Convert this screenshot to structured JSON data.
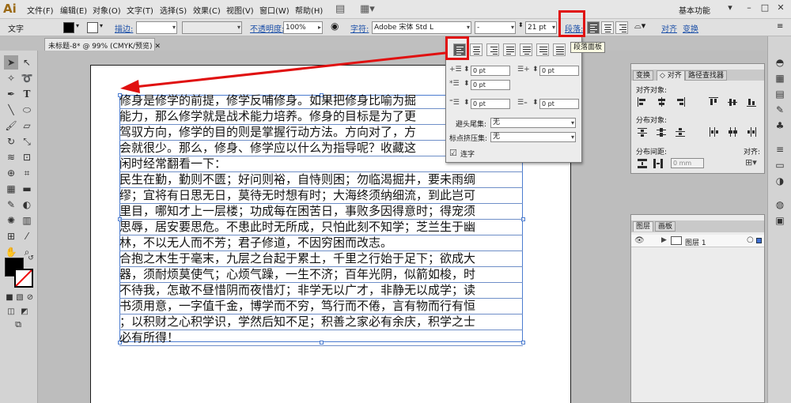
{
  "app": {
    "logo": "Ai"
  },
  "menu": [
    "文件(F)",
    "编辑(E)",
    "对象(O)",
    "文字(T)",
    "选择(S)",
    "效果(C)",
    "视图(V)",
    "窗口(W)",
    "帮助(H)"
  ],
  "workspace": "基本功能",
  "control": {
    "mode": "文字",
    "stroke_label": "描边:",
    "opacity_label": "不透明度:",
    "opacity_value": "100%",
    "char_label": "字符:",
    "font_name": "Adobe 宋体 Std L",
    "font_style": "-",
    "font_size": "21 pt",
    "paragraph_label": "段落:",
    "align_link": "对齐",
    "transform_link": "变换"
  },
  "doc_tab": "未标题-8* @ 99% (CMYK/预览)",
  "paragraph_panel": {
    "indent_left": "0 pt",
    "indent_right": "0 pt",
    "first_line": "0 pt",
    "space_before": "0 pt",
    "space_after": "0 pt",
    "kinsoku_label": "避头尾集:",
    "kinsoku_value": "无",
    "mojikumi_label": "标点挤压集:",
    "mojikumi_value": "无",
    "hyphen_label": "连字"
  },
  "tooltip": "段落面板",
  "align_panel": {
    "tabs": [
      "变换",
      "◇ 对齐",
      "路径查找器"
    ],
    "align_objects": "对齐对象:",
    "distribute_objects": "分布对象:",
    "distribute_spacing": "分布间距:",
    "align_to": "对齐:",
    "spacing_value": "0 mm"
  },
  "layers_panel": {
    "tabs": [
      "图层",
      "画板"
    ],
    "layer_name": "图层 1"
  },
  "text_lines": [
    "修身是修学的前提，修学反哺修身。如果把修身比喻为掘",
    "能力，那么修学就是战术能力培养。修身的目标是为了更",
    "驾驭方向，修学的目的则是掌握行动方法。方向对了，方",
    "会就很少。那么，修身、修学应以什么为指导呢？收藏这",
    "闲时经常翻看一下：",
    "民生在勤，勤则不匮；好问则裕，自恃则困；勿临渴掘井，要未雨绸",
    "缪；宜将有日思无日，莫待无时想有时；大海终须纳细流，到此岂可",
    "里目，哪知才上一层楼；功成每在困苦日，事败多因得意时；得宠须",
    "思辱，居安要思危。不患此时无所成，只怕此刻不知学；芝兰生于幽",
    "林，不以无人而不芳；君子修道，不因穷困而改志。",
    "合抱之木生于毫末，九层之台起于累土，千里之行始于足下；欲成大",
    "器，须耐烦莫使气；心烦气躁，一生不济；百年光阴，似箭如梭，时",
    "不待我，怎敢不昼惜阴而夜惜灯；非学无以广才，非静无以成学；读",
    "书须用意，一字值千金，博学而不穷，笃行而不倦，言有物而行有恒",
    "；以积财之心积学识，学然后知不足；积善之家必有余庆，积学之士",
    "必有所得！"
  ],
  "colors": {
    "highlight": "#e01010",
    "selection": "#4b7cd0",
    "link": "#1b4fa8"
  }
}
